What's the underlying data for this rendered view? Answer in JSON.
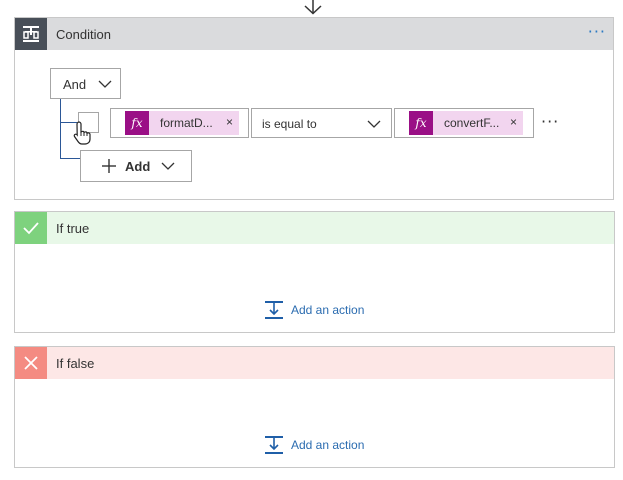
{
  "condition": {
    "title": "Condition",
    "more_menu": "···",
    "group_operator": "And",
    "row": {
      "left_token": "formatD...",
      "left_token_remove": "×",
      "operator": "is equal to",
      "right_token": "convertF...",
      "right_token_remove": "×",
      "fx_label": "fx",
      "more_menu": "···"
    },
    "add_label": "Add"
  },
  "if_true": {
    "title": "If true",
    "add_action_label": "Add an action"
  },
  "if_false": {
    "title": "If false",
    "add_action_label": "Add an action"
  },
  "icons": {
    "top_arrow": "arrow-down-icon",
    "condition": "condition-icon",
    "check": "checkmark-icon",
    "close": "close-icon",
    "add_action": "add-action-icon",
    "plus": "plus-icon",
    "chevron": "chevron-down-icon",
    "cursor": "hand-cursor-icon"
  },
  "colors": {
    "accent": "#2b79c2",
    "token_bg": "#f2d5ef",
    "fx_bg": "#9a0f86",
    "true_header": "#e8f8e8",
    "true_icon": "#7ed27e",
    "false_header": "#fde7e6",
    "false_icon": "#f48b82",
    "condition_header": "#dadbdd",
    "condition_icon": "#484f58"
  }
}
